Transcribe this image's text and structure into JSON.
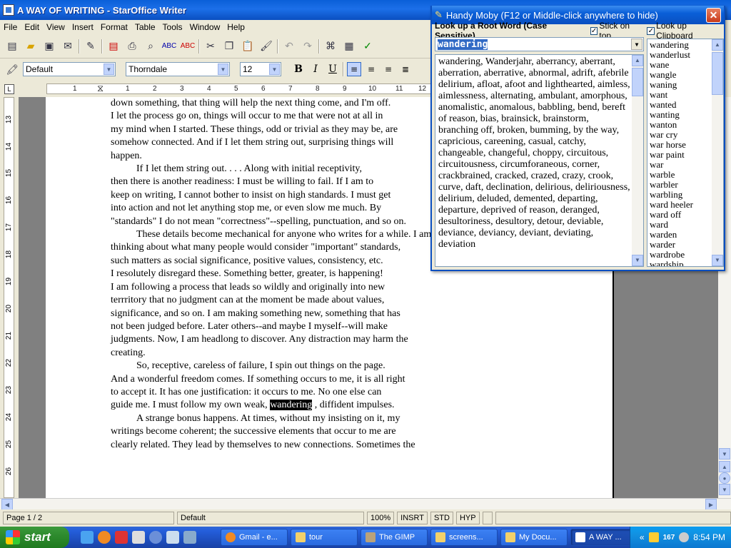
{
  "window": {
    "title": "A WAY OF WRITING - StarOffice Writer"
  },
  "menu": [
    "File",
    "Edit",
    "View",
    "Insert",
    "Format",
    "Table",
    "Tools",
    "Window",
    "Help"
  ],
  "format": {
    "style": "Default",
    "font": "Thorndale",
    "size": "12",
    "bold": "B",
    "italic": "I",
    "underline": "U"
  },
  "ruler": {
    "top_ticks": [
      "1",
      "1",
      "2",
      "3",
      "4",
      "5",
      "6",
      "7",
      "8",
      "9",
      "10",
      "11",
      "12"
    ],
    "left_ticks": [
      "13",
      "14",
      "15",
      "16",
      "17",
      "18",
      "19",
      "20",
      "21",
      "22",
      "23",
      "24",
      "25",
      "26"
    ]
  },
  "document": {
    "lines": [
      {
        "t": "down something, that thing will help the next thing come, and I'm off.",
        "indent": false
      },
      {
        "t": "I let the process go on, things will occur to me that were not at all in",
        "indent": false
      },
      {
        "t": "my mind when I started. These things, odd or trivial as they may be, are",
        "indent": false
      },
      {
        "t": "somehow connected. And if I let them string out, surprising things will",
        "indent": false
      },
      {
        "t": "happen.",
        "indent": false
      },
      {
        "t": "If I let them string out. . . . Along with initial receptivity,",
        "indent": true
      },
      {
        "t": "then there is another readiness: I must be willing to fail. If I am to",
        "indent": false
      },
      {
        "t": "keep on writing, I cannot bother to insist on high standards. I must get",
        "indent": false
      },
      {
        "t": "into action and not let anything stop me, or even slow me much. By",
        "indent": false
      },
      {
        "t": "\"standards\" I do not mean \"correctness\"--spelling, punctuation, and so on.",
        "indent": false
      },
      {
        "t": "These details become mechanical for anyone who writes for a while. I am",
        "indent": true
      },
      {
        "t": "thinking about what many people would consider \"important\" standards,",
        "indent": false
      },
      {
        "t": "such matters as social significance, positive values, consistency, etc.",
        "indent": false
      },
      {
        "t": "I resolutely disregard these. Something better, greater, is happening!",
        "indent": false
      },
      {
        "t": "I am following a process that leads so wildly and originally into new",
        "indent": false
      },
      {
        "t": "terrritory that no judgment can at the moment be made about values,",
        "indent": false
      },
      {
        "t": "significance, and so on. I am making something new, something that has",
        "indent": false
      },
      {
        "t": "not been judged before. Later others--and maybe I myself--will make",
        "indent": false
      },
      {
        "t": "judgments. Now, I am headlong to discover. Any distraction may harm the",
        "indent": false
      },
      {
        "t": "creating.",
        "indent": false
      },
      {
        "t": "So, receptive, careless of failure, I spin out things on the page.",
        "indent": true
      },
      {
        "t": "And a wonderful freedom comes. If something occurs to me, it is all right",
        "indent": false
      },
      {
        "t": "to accept it. It has one justification: it occurs to me. No one else can",
        "indent": false
      },
      {
        "t": "",
        "indent": false
      },
      {
        "t": "A strange bonus happens. At times, without my insisting on it, my",
        "indent": true
      },
      {
        "t": "writings become coherent; the successive elements that occur to me are",
        "indent": false
      },
      {
        "t": "clearly related. They lead by themselves to new connections. Sometimes the",
        "indent": false
      }
    ],
    "hl_before": "guide me. I must follow my own weak, ",
    "hl_word": "wandering",
    "hl_after": " , diffident impulses."
  },
  "status": {
    "page": "Page 1 / 2",
    "style": "Default",
    "zoom": "100%",
    "mode": "INSRT",
    "sel": "STD",
    "hyp": "HYP"
  },
  "moby": {
    "title": "Handy Moby (F12 or Middle-click anywhere to hide)",
    "lookup_label": "Look up a Root Word (Case Sensitive)",
    "stick_label": "Stick on top",
    "clip_label": "Look up Clipboard",
    "query": "wandering",
    "synonyms": "wandering, Wanderjahr, aberrancy, aberrant, aberration, aberrative, abnormal, adrift, afebrile delirium, afloat, afoot and lighthearted, aimless, aimlessness, alternating, ambulant, amorphous, anomalistic, anomalous, babbling, bend, bereft of reason, bias, brainsick, brainstorm, branching off, broken, bumming, by the way, capricious, careening, casual, catchy, changeable, changeful, choppy, circuitous, circuitousness, circumforaneous, corner, crackbrained, cracked, crazed, crazy, crook, curve, daft, declination, delirious, deliriousness, delirium, deluded, demented, departing, departure, deprived of reason, deranged, desultoriness, desultory, detour, deviable, deviance, deviancy, deviant, deviating, deviation",
    "words": [
      "wandering",
      "wanderlust",
      "wane",
      "wangle",
      "waning",
      "want",
      "wanted",
      "wanting",
      "wanton",
      "war cry",
      "war horse",
      "war paint",
      "war",
      "warble",
      "warbler",
      "warbling",
      "ward heeler",
      "ward off",
      "ward",
      "warden",
      "warder",
      "wardrobe",
      "wardship"
    ]
  },
  "taskbar": {
    "start": "start",
    "tasks": [
      "Gmail - e...",
      "tour",
      "The GIMP",
      "screens...",
      "My Docu...",
      "A WAY ..."
    ],
    "clock": "8:54 PM",
    "tray_count": "167"
  },
  "colors": {
    "titlebar": "#0a5fd8",
    "highlight": "#000000",
    "taskbar": "#245edb",
    "start": "#2e8b2e"
  }
}
